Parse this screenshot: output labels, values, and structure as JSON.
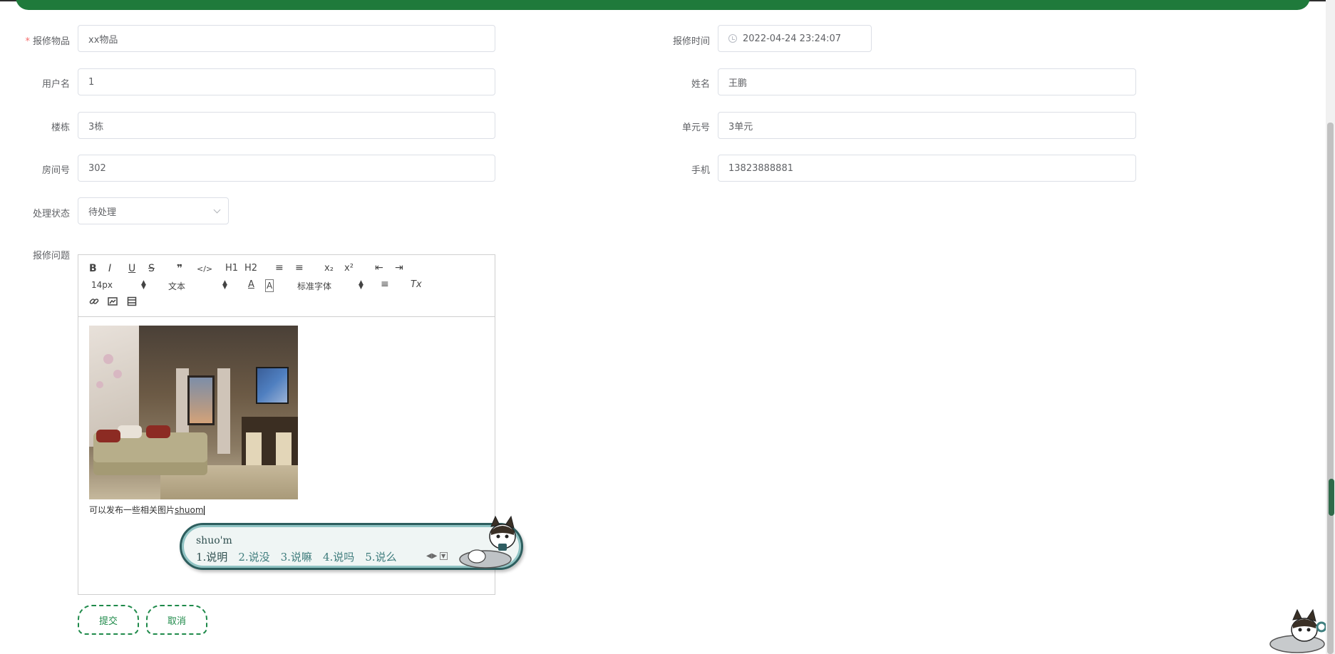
{
  "form": {
    "item": {
      "label": "报修物品",
      "required_mark": "*",
      "value": "xx物品"
    },
    "report_time": {
      "label": "报修时间",
      "value": "2022-04-24 23:24:07"
    },
    "username": {
      "label": "用户名",
      "value": "1"
    },
    "name": {
      "label": "姓名",
      "value": "王鹏"
    },
    "building": {
      "label": "楼栋",
      "value": "3栋"
    },
    "unit": {
      "label": "单元号",
      "value": "3单元"
    },
    "room": {
      "label": "房间号",
      "value": "302"
    },
    "phone": {
      "label": "手机",
      "value": "13823888881"
    },
    "status": {
      "label": "处理状态",
      "value": "待处理"
    },
    "problem": {
      "label": "报修问题"
    }
  },
  "editor": {
    "toolbar": {
      "bold": "B",
      "italic": "I",
      "underline": "U",
      "strike": "S",
      "quote": "❞",
      "code": "</>",
      "h1": "H1",
      "h2": "H2",
      "ordered_list": "≡",
      "bullet_list": "≡",
      "subscript": "x₂",
      "superscript": "x²",
      "outdent": "⇤",
      "indent": "⇥",
      "size": "14px",
      "header": "文本",
      "font": "标准字体",
      "color": "A",
      "background": "A",
      "align": "≡",
      "clean": "Tx",
      "link": "link-icon",
      "image": "image-icon",
      "video": "video-icon"
    },
    "content_text": "可以发布一些相关图片",
    "typing_text": "shuom"
  },
  "ime": {
    "pinyin": "shuo'm",
    "candidates": [
      "1.说明",
      "2.说没",
      "3.说嘛",
      "4.说吗",
      "5.说么"
    ]
  },
  "buttons": {
    "submit": "提交",
    "cancel": "取消"
  },
  "colors": {
    "accent": "#1f8a4a",
    "header_bar": "#1f7a3b",
    "required": "#f56c6c"
  }
}
